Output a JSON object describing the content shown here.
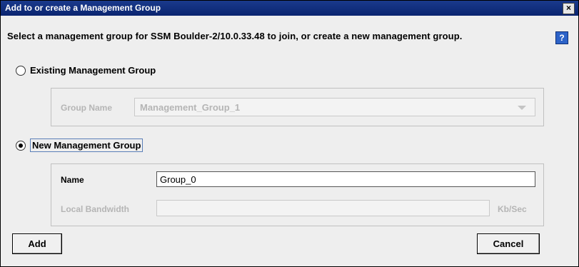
{
  "window": {
    "title": "Add to or create a Management Group",
    "close_label": "×"
  },
  "instruction": "Select a management group for SSM Boulder-2/10.0.33.48 to join, or create a new management group.",
  "help_label": "?",
  "existing": {
    "radio_label": "Existing Management Group",
    "checked": false,
    "group_name_label": "Group Name",
    "group_name_value": "Management_Group_1"
  },
  "new_group": {
    "radio_label": "New Management Group",
    "checked": true,
    "name_label": "Name",
    "name_value": "Group_0",
    "bandwidth_label": "Local Bandwidth",
    "bandwidth_value": "",
    "bandwidth_unit": "Kb/Sec"
  },
  "buttons": {
    "add": "Add",
    "cancel": "Cancel"
  }
}
